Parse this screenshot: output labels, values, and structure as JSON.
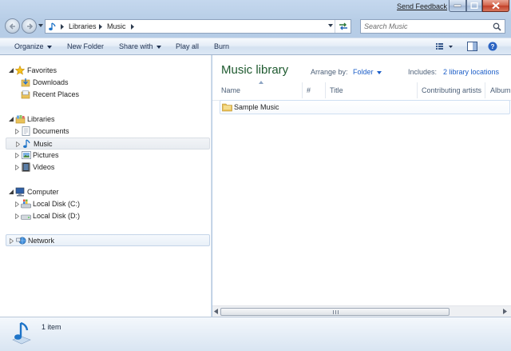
{
  "window": {
    "feedback_link": "Send Feedback"
  },
  "address_bar": {
    "crumbs": [
      "Libraries",
      "Music"
    ]
  },
  "search": {
    "placeholder": "Search Music"
  },
  "toolbar": {
    "organize": "Organize",
    "new_folder": "New Folder",
    "share_with": "Share with",
    "play_all": "Play all",
    "burn": "Burn"
  },
  "nav_pane": {
    "favorites": {
      "label": "Favorites",
      "items": [
        "Downloads",
        "Recent Places"
      ]
    },
    "libraries": {
      "label": "Libraries",
      "items": [
        "Documents",
        "Music",
        "Pictures",
        "Videos"
      ],
      "selected": "Music"
    },
    "computer": {
      "label": "Computer",
      "items": [
        "Local Disk (C:)",
        "Local Disk (D:)"
      ]
    },
    "network": {
      "label": "Network"
    }
  },
  "library": {
    "title": "Music library",
    "arrange_by_label": "Arrange by:",
    "arrange_by_value": "Folder",
    "includes_label": "Includes:",
    "includes_value": "2 library locations"
  },
  "columns": [
    "Name",
    "#",
    "Title",
    "Contributing artists",
    "Album"
  ],
  "files": [
    {
      "name": "Sample Music",
      "type": "folder"
    }
  ],
  "status": {
    "item_count": "1 item"
  },
  "colors": {
    "library_title": "#1e5a2f",
    "link": "#1c5ec8",
    "toolbar_text": "#1e3050"
  }
}
